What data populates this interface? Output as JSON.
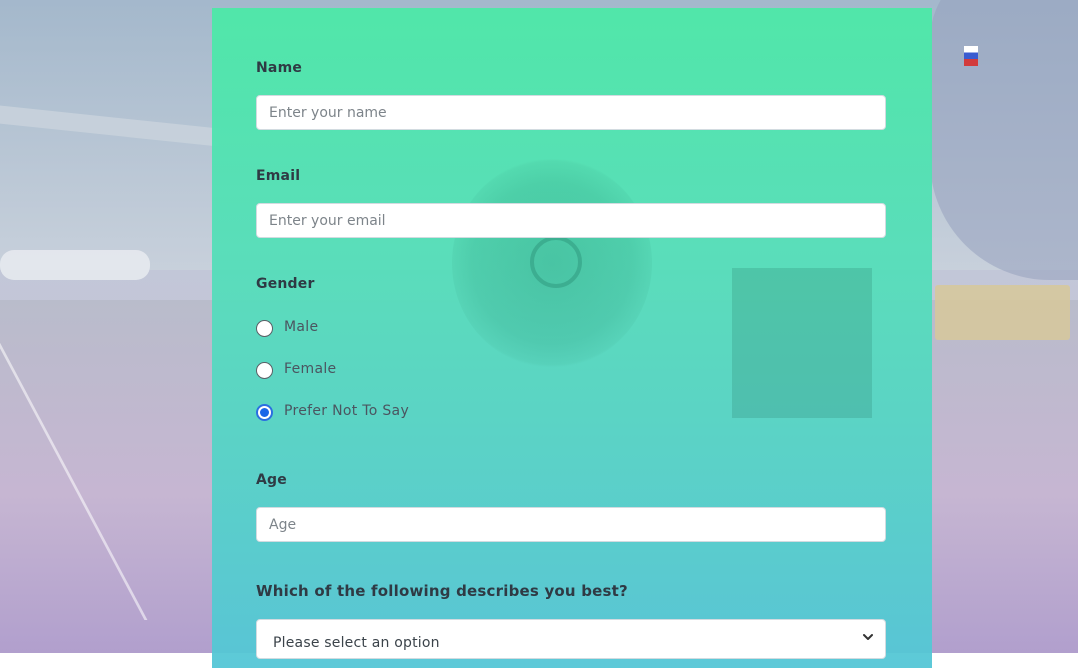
{
  "form": {
    "name": {
      "label": "Name",
      "placeholder": "Enter your name",
      "value": ""
    },
    "email": {
      "label": "Email",
      "placeholder": "Enter your email",
      "value": ""
    },
    "gender": {
      "label": "Gender",
      "options": [
        {
          "label": "Male",
          "checked": false
        },
        {
          "label": "Female",
          "checked": false
        },
        {
          "label": "Prefer Not To Say",
          "checked": true
        }
      ]
    },
    "age": {
      "label": "Age",
      "placeholder": "Age",
      "value": ""
    },
    "role": {
      "question": "Which of the following describes you best?",
      "selected": "Please select an option"
    }
  },
  "colors": {
    "card_top": "#4ee8a8",
    "card_bottom": "#54c6d6",
    "radio_selected": "#1a66e8",
    "label_text": "#2f3a44"
  },
  "icons": {
    "select_arrow": "chevron-down-icon"
  }
}
